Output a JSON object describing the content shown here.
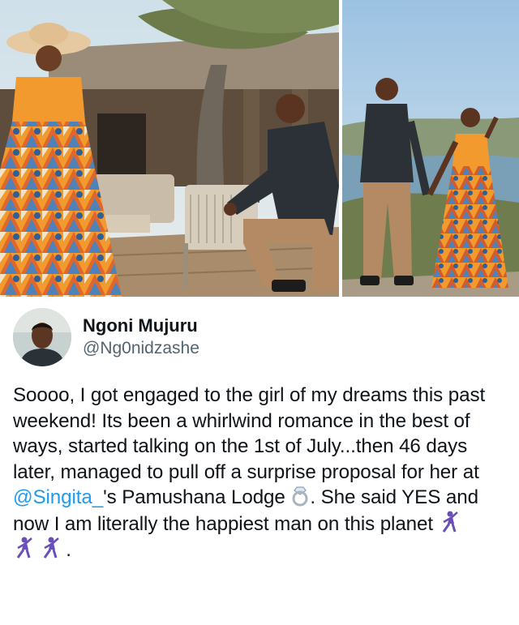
{
  "tweet": {
    "display_name": "Ngoni Mujuru",
    "handle": "@Ng0nidzashe",
    "text_part1": "Soooo, I got engaged to the girl of my dreams this past weekend! Its been a whirlwind romance in the best of ways, started talking on the 1st of July...then 46 days later, managed to pull off a surprise proposal for her at ",
    "mention": "@Singita_",
    "text_part2": "'s Pamushana Lodge ",
    "text_part3": ". She said YES and now I am literally the happiest man on this planet ",
    "text_end": "."
  },
  "emoji": {
    "ring": "ring-emoji",
    "dancer": "man-dancing-emoji"
  },
  "colors": {
    "text": "#0f1419",
    "handle": "#536471",
    "mention": "#1d9bf0",
    "dress_orange": "#f29a2e",
    "shirt_dark": "#2b3136",
    "sky": "#b9d5ea"
  }
}
